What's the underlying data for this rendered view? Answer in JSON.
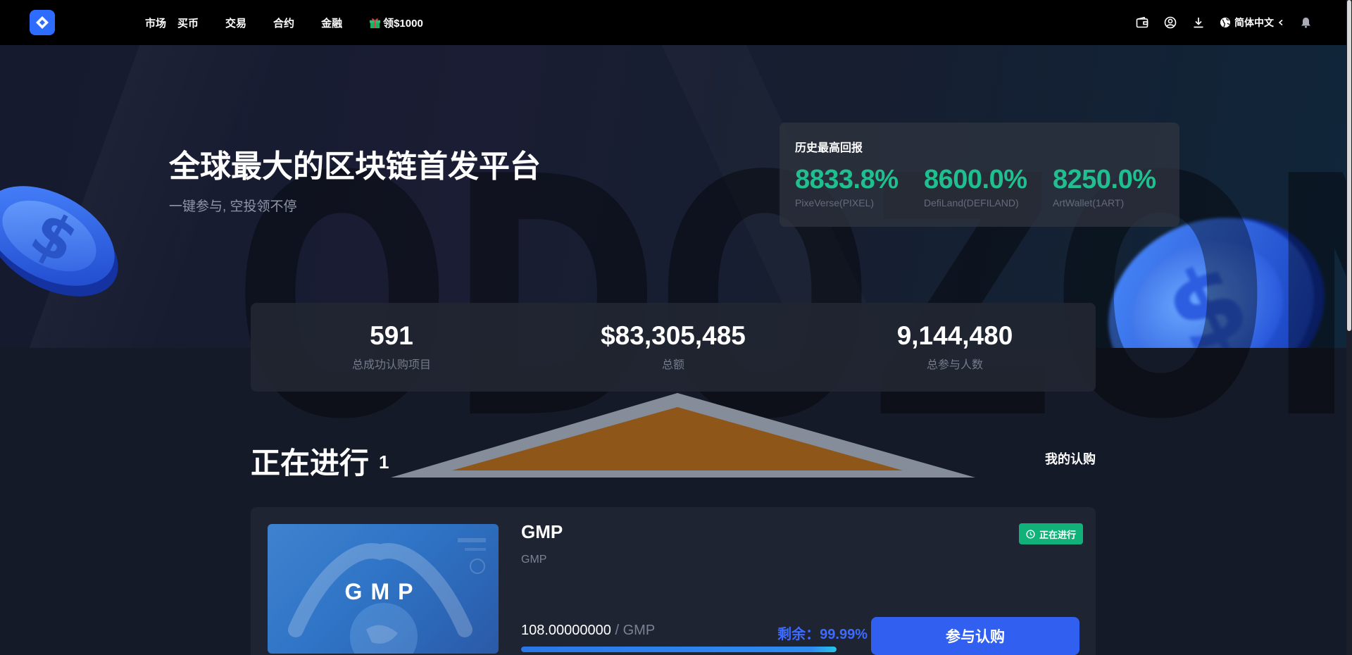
{
  "nav": {
    "items": [
      "市场",
      "买币",
      "交易",
      "合约",
      "金融"
    ],
    "promo_label": "领$1000",
    "language": "简体中文"
  },
  "hero": {
    "title": "全球最大的区块链首发平台",
    "subtitle": "一键参与, 空投领不停",
    "watermark": "ODOZON"
  },
  "returns": {
    "title": "历史最高回报",
    "items": [
      {
        "value": "8833.8%",
        "name": "PixeVerse(PIXEL)"
      },
      {
        "value": "8600.0%",
        "name": "DefiLand(DEFILAND)"
      },
      {
        "value": "8250.0%",
        "name": "ArtWallet(1ART)"
      }
    ]
  },
  "stats": [
    {
      "value": "591",
      "label": "总成功认购项目"
    },
    {
      "value": "$83,305,485",
      "label": "总额"
    },
    {
      "value": "9,144,480",
      "label": "总参与人数"
    }
  ],
  "section": {
    "title": "正在进行",
    "count": "1",
    "my_subscriptions": "我的认购"
  },
  "project": {
    "image_text": "GMP",
    "name": "GMP",
    "symbol": "GMP",
    "status": "正在进行",
    "price": "108.00000000",
    "price_unit": "/ GMP",
    "remaining": "剩余：99.99%",
    "remaining_fraction": 0.9999,
    "button": "参与认购"
  },
  "colors": {
    "accent": "#3160f0",
    "positive": "#1fbf8f",
    "status_badge": "#10b27a"
  }
}
